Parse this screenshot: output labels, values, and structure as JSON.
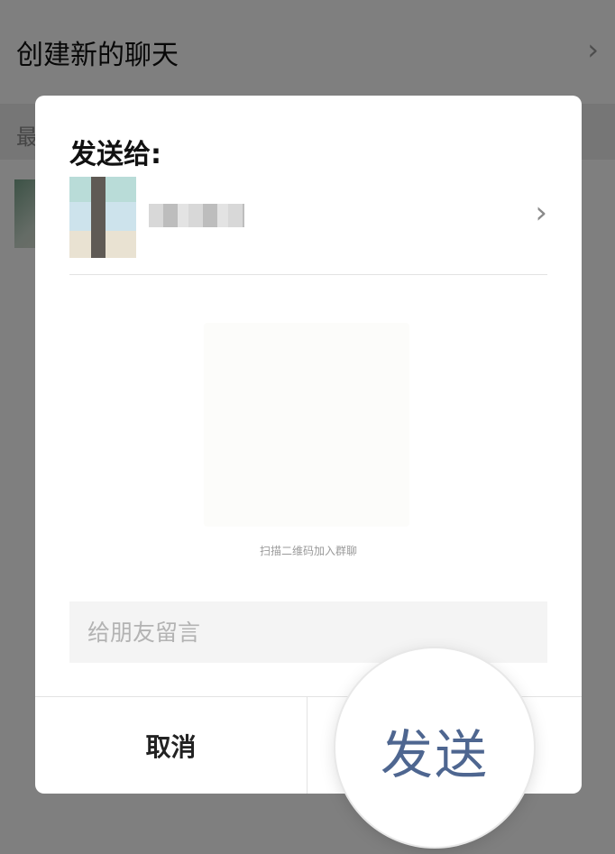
{
  "background": {
    "header_title": "创建新的聊天",
    "section_label": "最"
  },
  "dialog": {
    "title": "发送给:",
    "recipient": {
      "name": ""
    },
    "qr_caption": "扫描二维码加入群聊",
    "message_placeholder": "给朋友留言",
    "cancel_label": "取消",
    "send_label": "发送"
  },
  "colors": {
    "send_text": "#4e6690",
    "overlay": "rgba(0,0,0,0.5)"
  },
  "icons": {
    "background_chevron": "chevron-right-icon",
    "recipient_chevron": "chevron-right-icon"
  }
}
